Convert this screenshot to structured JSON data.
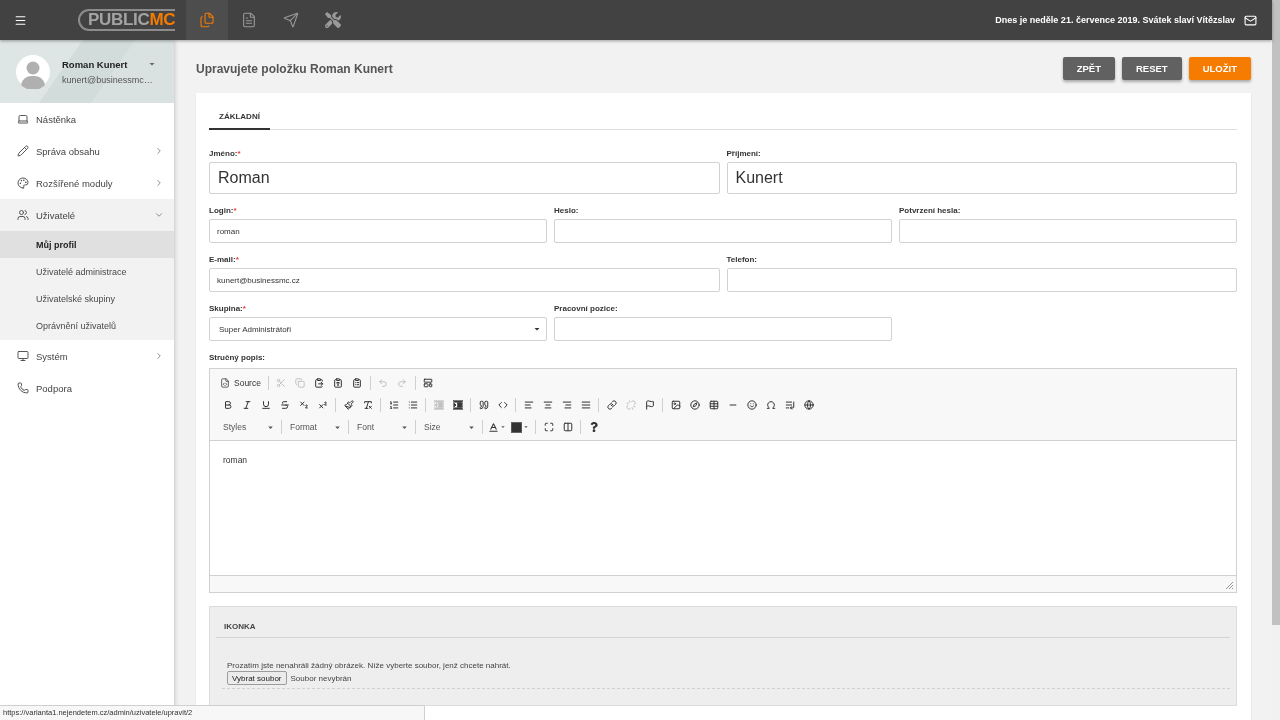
{
  "top_bar": {
    "logo": {
      "text": "PUBLIC",
      "accent": "MC"
    },
    "nav_icons": [
      {
        "selected": true
      },
      {
        "selected": false
      },
      {
        "selected": false
      },
      {
        "selected": false
      }
    ],
    "date_text": "Dnes je neděle 21. července 2019. Svátek slaví Vítězslav"
  },
  "sidebar": {
    "user": {
      "name": "Roman Kunert",
      "email": "kunert@businessmc…"
    },
    "items": [
      {
        "kind": "link",
        "label": "Nástěnka"
      },
      {
        "kind": "group",
        "label": "Správa obsahu",
        "expanded": false
      },
      {
        "kind": "group",
        "label": "Rozšířené moduly",
        "expanded": false
      },
      {
        "kind": "group",
        "label": "Uživatelé",
        "expanded": true,
        "children": [
          {
            "label": "Můj profil",
            "selected": true
          },
          {
            "label": "Uživatelé administrace",
            "selected": false
          },
          {
            "label": "Uživatelské skupiny",
            "selected": false
          },
          {
            "label": "Oprávnění uživatelů",
            "selected": false
          }
        ]
      },
      {
        "kind": "group",
        "label": "Systém",
        "expanded": false
      },
      {
        "kind": "link",
        "label": "Podpora"
      }
    ]
  },
  "page": {
    "title": "Upravujete položku Roman Kunert",
    "buttons": [
      {
        "label": "ZPĚT",
        "kind": "secondary"
      },
      {
        "label": "RESET",
        "kind": "secondary"
      },
      {
        "label": "ULOŽIT",
        "kind": "primary"
      }
    ]
  },
  "tabs": [
    {
      "label": "ZÁKLADNÍ",
      "selected": true
    }
  ],
  "form": {
    "rows": [
      [
        {
          "label": "Jméno:",
          "required_mark": "*",
          "kind": "text",
          "value": "Roman"
        },
        {
          "label": "Příjmení:",
          "kind": "text",
          "value": "Kunert"
        }
      ],
      [
        {
          "label": "Login:",
          "required_mark": "*",
          "kind": "text",
          "value": "roman"
        },
        {
          "label": "Heslo:",
          "kind": "text"
        },
        {
          "label": "Potvrzení hesla:",
          "kind": "text"
        }
      ],
      [
        {
          "label": "E-mail:",
          "required_mark": "*",
          "kind": "text",
          "value": "kunert@businessmc.cz"
        },
        {
          "label": "Telefon:",
          "kind": "text"
        }
      ],
      [
        {
          "label": "Skupina:",
          "required_mark": "*",
          "kind": "select",
          "value": "Super Administrátoři"
        },
        {
          "label": "Pracovní pozice:",
          "kind": "text"
        }
      ]
    ]
  },
  "editor": {
    "label": "Stručný popis:",
    "toolbar": [
      [
        [
          {
            "kind": "text_button",
            "label": "Source",
            "disabled": false
          }
        ],
        [
          {
            "kind": "icon",
            "disabled": true
          },
          {
            "kind": "icon",
            "disabled": true
          },
          {
            "kind": "icon",
            "disabled": false
          },
          {
            "kind": "icon",
            "disabled": false
          },
          {
            "kind": "icon",
            "disabled": false
          }
        ],
        [
          {
            "kind": "icon",
            "disabled": true
          },
          {
            "kind": "icon",
            "disabled": true
          }
        ],
        [
          {
            "kind": "icon",
            "disabled": false
          }
        ]
      ],
      [
        [
          {
            "kind": "icon",
            "disabled": false
          },
          {
            "kind": "icon",
            "disabled": false
          },
          {
            "kind": "icon",
            "disabled": false
          },
          {
            "kind": "icon",
            "disabled": false
          },
          {
            "kind": "icon",
            "disabled": false
          },
          {
            "kind": "icon",
            "disabled": false
          }
        ],
        [
          {
            "kind": "icon",
            "disabled": false
          },
          {
            "kind": "icon",
            "disabled": false
          }
        ],
        [
          {
            "kind": "icon",
            "disabled": false
          },
          {
            "kind": "icon",
            "disabled": false
          }
        ],
        [
          {
            "kind": "icon",
            "disabled": true
          },
          {
            "kind": "icon",
            "disabled": false
          }
        ],
        [
          {
            "kind": "icon",
            "disabled": false
          },
          {
            "kind": "icon",
            "disabled": false
          }
        ],
        [
          {
            "kind": "icon",
            "disabled": false
          },
          {
            "kind": "icon",
            "disabled": false
          },
          {
            "kind": "icon",
            "disabled": false
          },
          {
            "kind": "icon",
            "disabled": false
          }
        ],
        [
          {
            "kind": "icon",
            "disabled": false
          },
          {
            "kind": "icon",
            "disabled": true
          },
          {
            "kind": "icon",
            "disabled": false
          }
        ],
        [
          {
            "kind": "icon",
            "disabled": false
          },
          {
            "kind": "icon",
            "disabled": false
          },
          {
            "kind": "icon",
            "disabled": false
          },
          {
            "kind": "icon",
            "disabled": false
          },
          {
            "kind": "icon",
            "disabled": false
          },
          {
            "kind": "icon",
            "disabled": false
          },
          {
            "kind": "icon",
            "disabled": false
          },
          {
            "kind": "icon",
            "disabled": false
          }
        ]
      ],
      [
        [
          {
            "kind": "dropdown",
            "label": "Styles",
            "disabled": false
          }
        ],
        [
          {
            "kind": "dropdown",
            "label": "Format",
            "disabled": false
          }
        ],
        [
          {
            "kind": "dropdown",
            "label": "Font",
            "disabled": false
          }
        ],
        [
          {
            "kind": "dropdown",
            "label": "Size",
            "disabled": false
          }
        ],
        [
          {
            "kind": "color",
            "disabled": false
          },
          {
            "kind": "color",
            "disabled": false
          }
        ],
        [
          {
            "kind": "icon",
            "disabled": false
          },
          {
            "kind": "icon",
            "disabled": false
          }
        ],
        [
          {
            "kind": "icon",
            "disabled": false
          }
        ]
      ]
    ],
    "content": "roman"
  },
  "icon_panel": {
    "title": "IKONKA",
    "message": "Prozatím jste nenahráli žádný obrázek. Níže vyberte soubor, jenž chcete nahrát.",
    "file_button": "Vybrat soubor",
    "file_status": "Soubor nevybrán"
  },
  "status_url": "https://varianta1.nejendetem.cz/admin/uzivatele/upravit/2"
}
